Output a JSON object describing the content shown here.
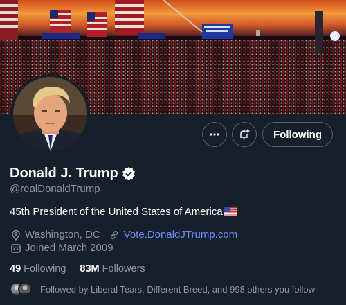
{
  "profile": {
    "name": "Donald J. Trump",
    "handle": "@realDonaldTrump",
    "bio": "45th President of the United States of America",
    "bio_flag_icon": "us-flag-icon",
    "location": "Washington, DC",
    "website": "Vote.DonaldJTrump.com",
    "joined": "Joined March 2009",
    "verified_icon": "verified-badge-icon"
  },
  "stats": {
    "following_count": "49",
    "following_label": "Following",
    "followers_count": "83M",
    "followers_label": "Followers"
  },
  "actions": {
    "more_icon": "more-horizontal-icon",
    "notify_icon": "bell-plus-icon",
    "following_label": "Following"
  },
  "followed_by": {
    "text": "Followed by Liberal Tears, Different Breed, and 998 others you follow"
  },
  "colors": {
    "background": "#15202b",
    "muted_text": "#8b98a5",
    "link": "#6c8cff",
    "border": "#536471"
  }
}
